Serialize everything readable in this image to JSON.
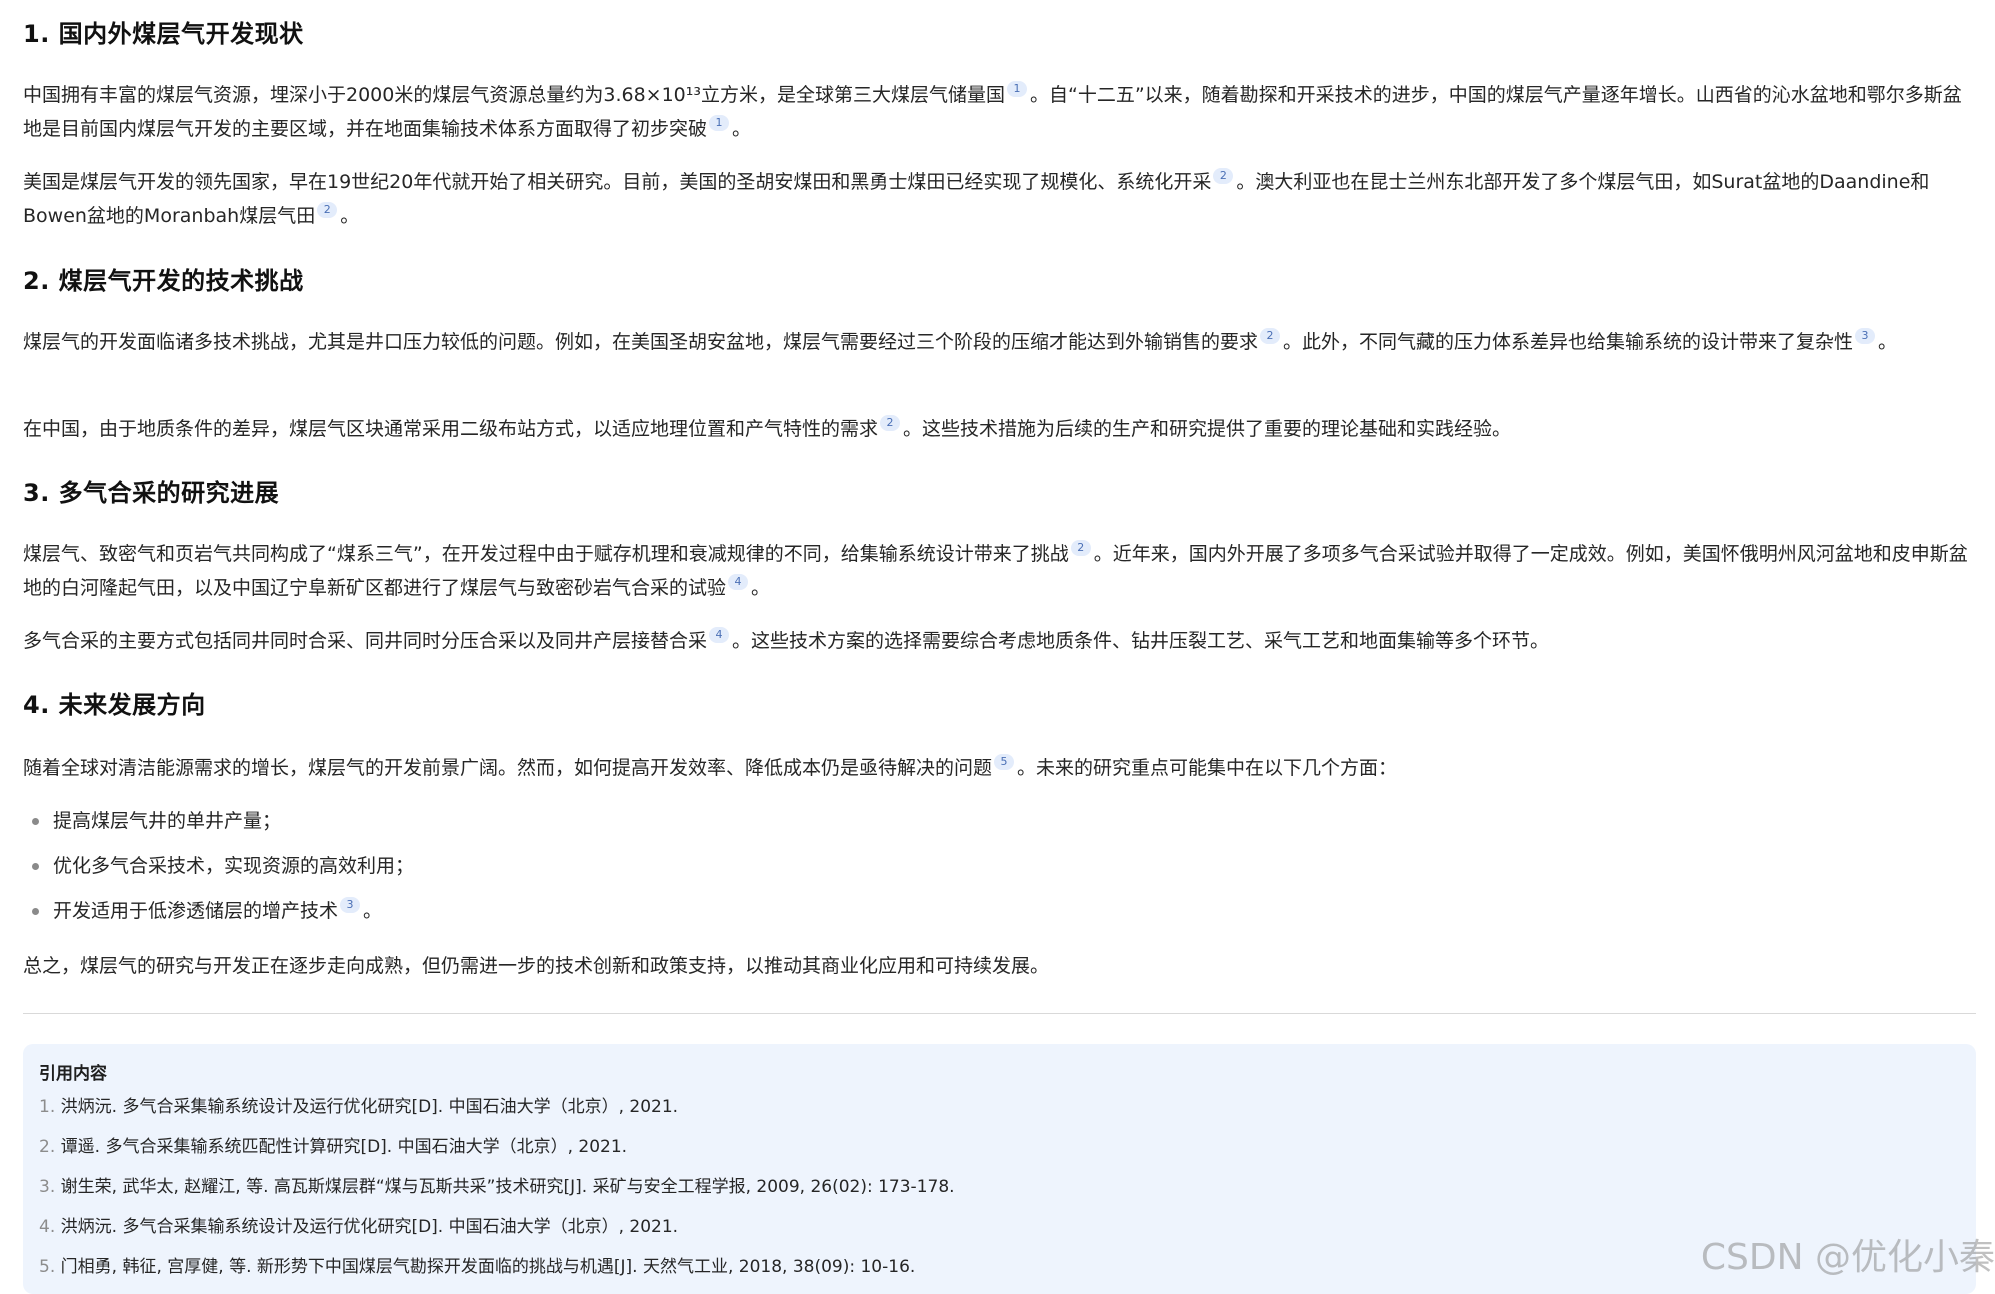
{
  "sections": [
    {
      "heading": "1. 国内外煤层气开发现状",
      "paragraphs": [
        {
          "parts": [
            {
              "text": "中国拥有丰富的煤层气资源，埋深小于2000米的煤层气资源总量约为3.68×10¹³立方米，是全球第三大煤层气储量国"
            },
            {
              "cite": "1"
            },
            {
              "text": "。自“十二五”以来，随着勘探和开采技术的进步，中国的煤层气产量逐年增长。山西省的沁水盆地和鄂尔多斯盆地是目前国内煤层气开发的主要区域，并在地面集输技术体系方面取得了初步突破"
            },
            {
              "cite": "1"
            },
            {
              "text": "。"
            }
          ]
        },
        {
          "parts": [
            {
              "text": "美国是煤层气开发的领先国家，早在19世纪20年代就开始了相关研究。目前，美国的圣胡安煤田和黑勇士煤田已经实现了规模化、系统化开采"
            },
            {
              "cite": "2"
            },
            {
              "text": "。澳大利亚也在昆士兰州东北部开发了多个煤层气田，如Surat盆地的Daandine和Bowen盆地的Moranbah煤层气田"
            },
            {
              "cite": "2"
            },
            {
              "text": "。"
            }
          ]
        }
      ]
    },
    {
      "heading": "2. 煤层气开发的技术挑战",
      "paragraphs": [
        {
          "parts": [
            {
              "text": "煤层气的开发面临诸多技术挑战，尤其是井口压力较低的问题。例如，在美国圣胡安盆地，煤层气需要经过三个阶段的压缩才能达到外输销售的要求"
            },
            {
              "cite": "2"
            },
            {
              "text": "。此外，不同气藏的压力体系差异也给集输系统的设计带来了复杂性"
            },
            {
              "cite": "3"
            },
            {
              "text": "。"
            }
          ]
        },
        {
          "parts": [
            {
              "text": "在中国，由于地质条件的差异，煤层气区块通常采用二级布站方式，以适应地理位置和产气特性的需求"
            },
            {
              "cite": "2"
            },
            {
              "text": "。这些技术措施为后续的生产和研究提供了重要的理论基础和实践经验。"
            }
          ]
        }
      ]
    },
    {
      "heading": "3. 多气合采的研究进展",
      "paragraphs": [
        {
          "parts": [
            {
              "text": "煤层气、致密气和页岩气共同构成了“煤系三气”，在开发过程中由于赋存机理和衰减规律的不同，给集输系统设计带来了挑战"
            },
            {
              "cite": "2"
            },
            {
              "text": "。近年来，国内外开展了多项多气合采试验并取得了一定成效。例如，美国怀俄明州风河盆地和皮申斯盆地的白河隆起气田，以及中国辽宁阜新矿区都进行了煤层气与致密砂岩气合采的试验"
            },
            {
              "cite": "4"
            },
            {
              "text": "。"
            }
          ]
        },
        {
          "parts": [
            {
              "text": "多气合采的主要方式包括同井同时合采、同井同时分压合采以及同井产层接替合采"
            },
            {
              "cite": "4"
            },
            {
              "text": "。这些技术方案的选择需要综合考虑地质条件、钻井压裂工艺、采气工艺和地面集输等多个环节。"
            }
          ]
        }
      ]
    },
    {
      "heading": "4. 未来发展方向",
      "paragraphs": [
        {
          "parts": [
            {
              "text": "随着全球对清洁能源需求的增长，煤层气的开发前景广阔。然而，如何提高开发效率、降低成本仍是亟待解决的问题"
            },
            {
              "cite": "5"
            },
            {
              "text": "。未来的研究重点可能集中在以下几个方面："
            }
          ]
        }
      ],
      "bullets": [
        {
          "parts": [
            {
              "text": "提高煤层气井的单井产量；"
            }
          ]
        },
        {
          "parts": [
            {
              "text": "优化多气合采技术，实现资源的高效利用；"
            }
          ]
        },
        {
          "parts": [
            {
              "text": "开发适用于低渗透储层的增产技术"
            },
            {
              "cite": "3"
            },
            {
              "text": "。"
            }
          ]
        }
      ],
      "closing": {
        "parts": [
          {
            "text": "总之，煤层气的研究与开发正在逐步走向成熟，但仍需进一步的技术创新和政策支持，以推动其商业化应用和可持续发展。"
          }
        ]
      }
    }
  ],
  "references": {
    "title": "引用内容",
    "items": [
      {
        "num": "1.",
        "text": "洪炳沅. 多气合采集输系统设计及运行优化研究[D]. 中国石油大学（北京）, 2021."
      },
      {
        "num": "2.",
        "text": "谭遥. 多气合采集输系统匹配性计算研究[D]. 中国石油大学（北京）, 2021."
      },
      {
        "num": "3.",
        "text": "谢生荣, 武华太, 赵耀江, 等. 高瓦斯煤层群“煤与瓦斯共采”技术研究[J]. 采矿与安全工程学报, 2009, 26(02): 173-178."
      },
      {
        "num": "4.",
        "text": "洪炳沅. 多气合采集输系统设计及运行优化研究[D]. 中国石油大学（北京）, 2021."
      },
      {
        "num": "5.",
        "text": "门相勇, 韩征, 宫厚健, 等. 新形势下中国煤层气勘探开发面临的挑战与机遇[J]. 天然气工业, 2018, 38(09): 10-16."
      }
    ]
  },
  "watermark": "CSDN @优化小秦",
  "colors": {
    "citation_bg": "#e3ecfb",
    "citation_fg": "#4a6fb5",
    "refs_bg": "#eef4fd"
  }
}
